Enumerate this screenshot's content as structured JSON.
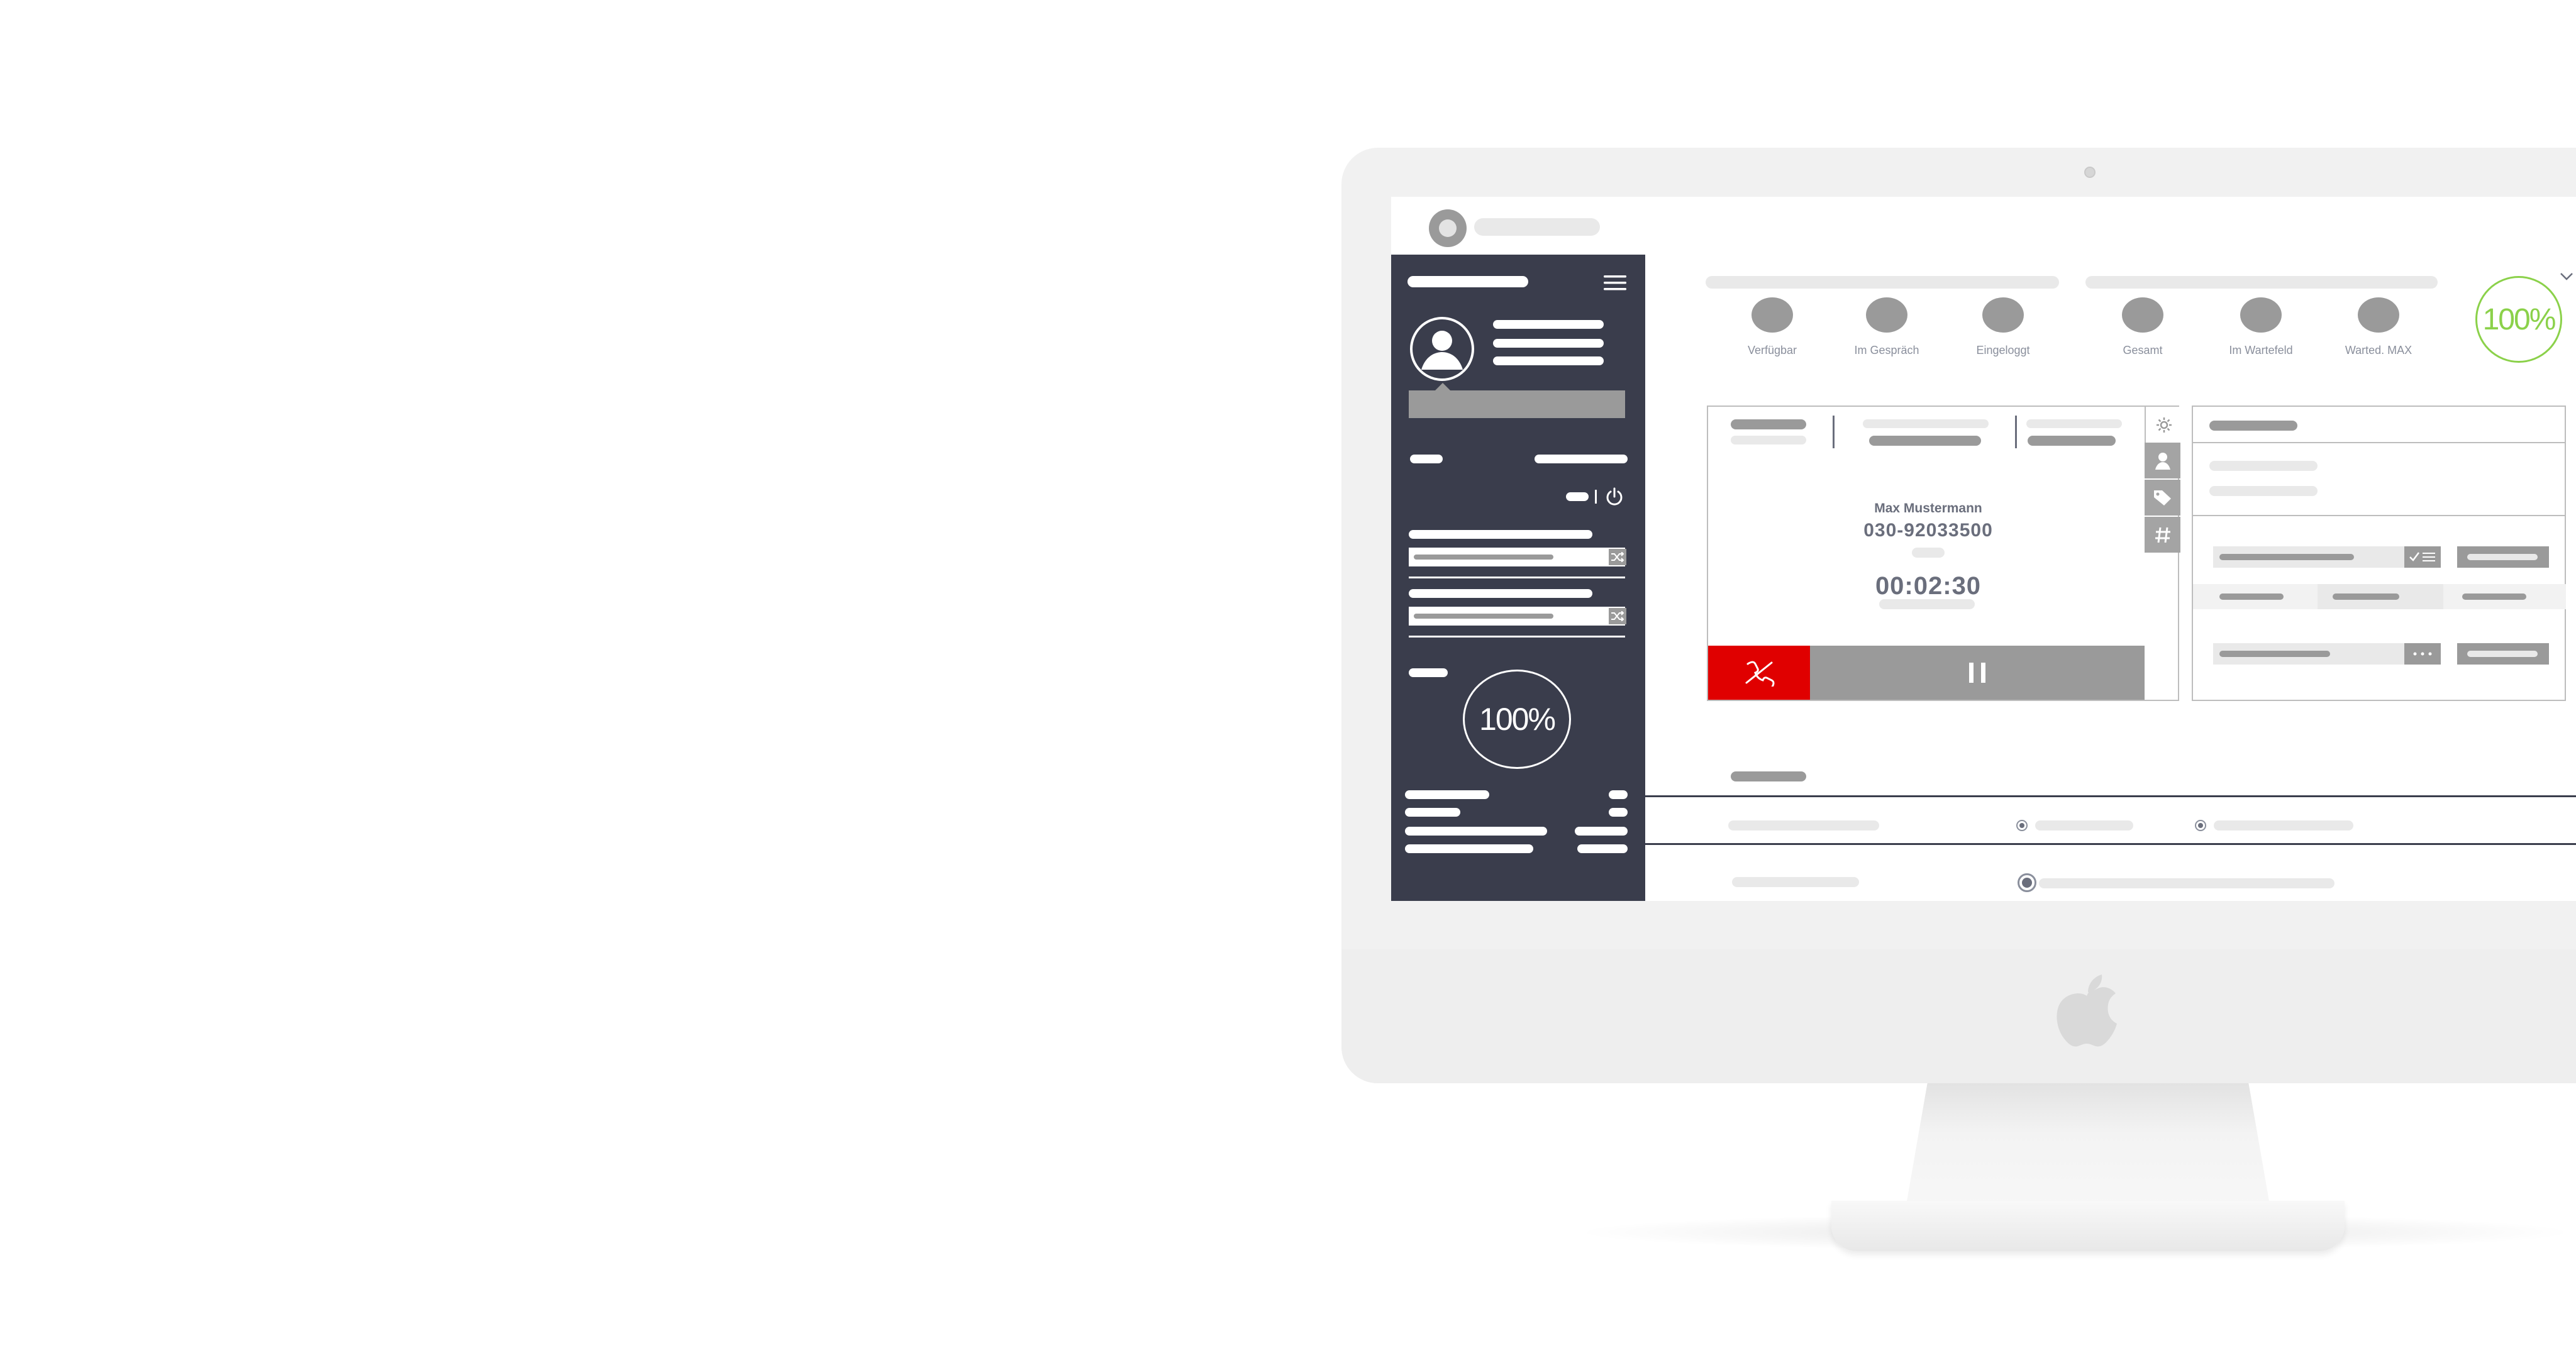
{
  "app": {
    "menu_icon": "hamburger-menu-icon",
    "logo_icon": "app-logo-icon"
  },
  "stats": [
    {
      "label": "Verfügbar"
    },
    {
      "label": "Im Gespräch"
    },
    {
      "label": "Eingeloggt"
    },
    {
      "label": "Gesamt"
    },
    {
      "label": "Im Wartefeld"
    },
    {
      "label": "Warted. MAX"
    }
  ],
  "top_gauge": {
    "value_text": "100%",
    "color": "#8bd14a"
  },
  "sidebar_gauge": {
    "value_text": "100%"
  },
  "call": {
    "name": "Max Mustermann",
    "number": "030-92033500",
    "timer": "00:02:30",
    "hangup_color": "#e00000",
    "hangup_icon": "hangup-phone-icon",
    "hold_icon": "pause-icon"
  },
  "call_side_tabs": [
    "gear-icon",
    "user-icon",
    "tag-icon",
    "hash-icon"
  ],
  "colors": {
    "sidebar": "#3a3d4c",
    "accent_green": "#8bd14a",
    "placeholder_grey": "#9a9a9a"
  },
  "hardware": {
    "brand_icon": "apple-logo-icon"
  }
}
